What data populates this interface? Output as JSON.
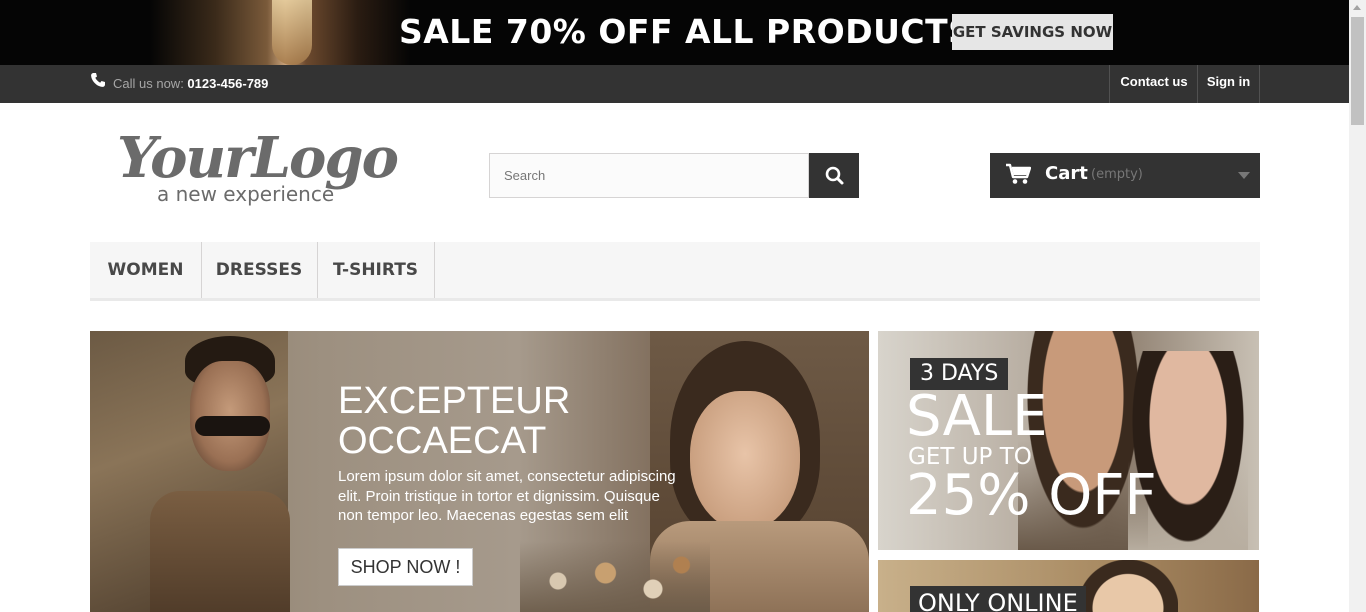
{
  "promo_banner": {
    "text": "SALE 70% OFF ALL PRODUCTS",
    "button_label": "GET SAVINGS NOW"
  },
  "topbar": {
    "call_label": "Call us now: ",
    "phone": "0123-456-789",
    "contact_label": "Contact us",
    "signin_label": "Sign in"
  },
  "header": {
    "logo_alt": "Your Logo — a new experience",
    "logo_main": "YourLogo",
    "logo_tagline": "a new experience",
    "search_placeholder": "Search",
    "cart_label": "Cart",
    "cart_status": "(empty)"
  },
  "menu": {
    "items": [
      "WOMEN",
      "DRESSES",
      "T-SHIRTS"
    ]
  },
  "slider": {
    "title_line1": "EXCEPTEUR",
    "title_line2": "OCCAECAT",
    "description": "Lorem ipsum dolor sit amet, consectetur adipiscing elit. Proin tristique in tortor et dignissim. Quisque non tempor leo. Maecenas egestas sem elit",
    "button_label": "SHOP NOW !"
  },
  "promo_blocks": {
    "sale": {
      "tag": "3 DAYS",
      "headline": "SALE",
      "subline": "GET UP TO",
      "percent": "25% OFF"
    },
    "online": {
      "tag": "ONLY ONLINE"
    }
  },
  "colors": {
    "dark": "#333333",
    "banner_bg": "#050505",
    "menu_bg": "#f6f6f6"
  },
  "icons": [
    "phone-icon",
    "search-icon",
    "cart-icon",
    "chevron-down-icon"
  ]
}
